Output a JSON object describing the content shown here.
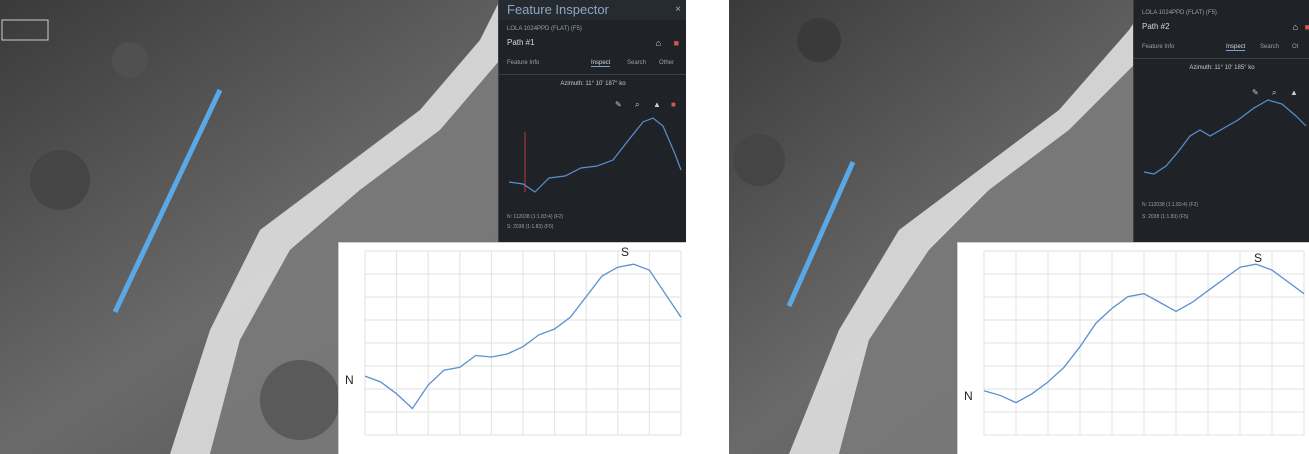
{
  "left": {
    "inspector": {
      "title": "Feature Inspector",
      "close_label": "×",
      "subtitle": "LOLA 1024PPD (FLAT) (F5)",
      "path_label": "Path #1",
      "tabs": [
        "Feature Info",
        "Inspect",
        "Search",
        "Other"
      ],
      "azimuth": "Azimuth: 11° 10′ 187° ko",
      "legend": [
        "N: 112038 (1:1.83:4) (F2)",
        "S: 2038 (1:1.83) (F5)"
      ]
    },
    "profile": {
      "n_label": "N",
      "s_label": "S"
    }
  },
  "right": {
    "inspector": {
      "subtitle": "LOLA 1024PPD (FLAT) (F5)",
      "path_label": "Path #2",
      "tabs": [
        "Feature Info",
        "Inspect",
        "Search",
        "Ot"
      ],
      "azimuth": "Azimuth: 11° 10′ 185° ko",
      "legend": [
        "N: 112038 (1:1.83:4) (F2)",
        "S: 2038 (1:1.83) (F5)"
      ]
    },
    "profile": {
      "n_label": "N",
      "s_label": "S"
    }
  },
  "colors": {
    "path_line": "#5aa9e6",
    "profile_line": "#5b8fd1",
    "inspector_bg": "#1f2328",
    "accent_red": "#d9534f"
  },
  "chart_data": [
    {
      "type": "line",
      "title": "",
      "x": [
        0,
        1,
        2,
        3,
        4,
        5,
        6,
        7,
        8,
        9,
        10,
        11,
        12,
        13,
        14,
        15,
        16,
        17,
        18,
        19,
        20
      ],
      "series": [
        {
          "values": [
            40,
            36,
            28,
            18,
            34,
            44,
            46,
            54,
            53,
            55,
            60,
            68,
            72,
            80,
            94,
            108,
            114,
            116,
            112,
            96,
            80
          ]
        }
      ],
      "annotations": [
        "N",
        "S"
      ]
    },
    {
      "type": "line",
      "title": "",
      "x": [
        0,
        1,
        2,
        3,
        4,
        5,
        6,
        7,
        8,
        9,
        10,
        11,
        12,
        13,
        14,
        15,
        16,
        17,
        18,
        19,
        20
      ],
      "series": [
        {
          "values": [
            30,
            27,
            22,
            28,
            36,
            46,
            60,
            76,
            86,
            94,
            96,
            90,
            84,
            90,
            98,
            106,
            114,
            116,
            112,
            104,
            96
          ]
        }
      ],
      "annotations": [
        "N",
        "S"
      ]
    }
  ]
}
